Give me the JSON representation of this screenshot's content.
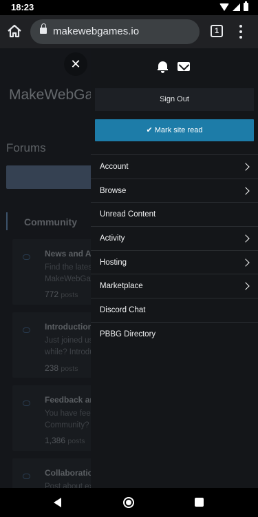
{
  "status_bar": {
    "time": "18:23",
    "icons": [
      "wifi-icon",
      "signal-icon",
      "battery-icon"
    ]
  },
  "browser": {
    "url": "makewebgames.io",
    "tab_count": "1",
    "icons": [
      "home-icon",
      "lock-icon",
      "tabs-icon",
      "overflow-menu-icon"
    ]
  },
  "page": {
    "close_symbol": "✕",
    "site_title": "MakeWebGames",
    "forums_title": "Forums",
    "section_title": "Community",
    "forums": [
      {
        "name": "News and Announcements",
        "description_lines": [
          "Find the latest news about",
          "MakeWebGames"
        ],
        "count": "772",
        "unit": "posts"
      },
      {
        "name": "Introductions",
        "description_lines": [
          "Just joined us? Been here a",
          "while? Introduce yourself"
        ],
        "count": "238",
        "unit": "posts"
      },
      {
        "name": "Feedback and Suggestions",
        "description_lines": [
          "You have feedback for the",
          "Community?"
        ],
        "count": "1,386",
        "unit": "posts"
      },
      {
        "name": "Collaboration",
        "description_lines": [
          "Post about existing"
        ],
        "count": "",
        "unit": ""
      }
    ]
  },
  "drawer": {
    "sign_out": "Sign Out",
    "mark_read": "Mark site read",
    "mark_read_icon": "checkmark-icon",
    "menu_items": [
      {
        "label": "Account",
        "has_submenu": true
      },
      {
        "label": "Browse",
        "has_submenu": true
      },
      {
        "label": "Unread Content",
        "has_submenu": false
      },
      {
        "label": "Activity",
        "has_submenu": true
      },
      {
        "label": "Hosting",
        "has_submenu": true
      },
      {
        "label": "Marketplace",
        "has_submenu": true
      },
      {
        "label": "Discord Chat",
        "has_submenu": false
      },
      {
        "label": "PBBG Directory",
        "has_submenu": false
      }
    ]
  },
  "colors": {
    "accent": "#1d7ca8",
    "drawer_bg": "#141619",
    "page_bg": "#1f2329"
  }
}
